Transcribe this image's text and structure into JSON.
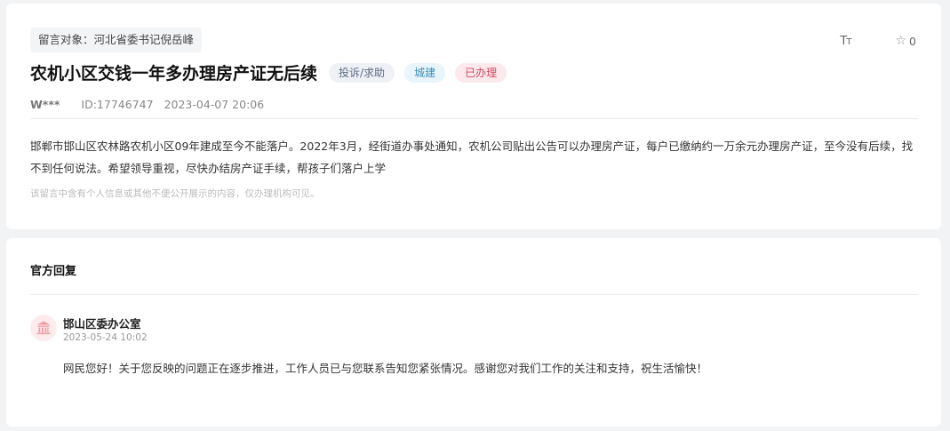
{
  "message": {
    "target_label": "留言对象：河北省委书记倪岳峰",
    "title": "农机小区交钱一年多办理房产证无后续",
    "tags": {
      "type": "投诉/求助",
      "category": "城建",
      "status": "已办理"
    },
    "user": "W***",
    "id": "ID:17746747",
    "datetime": "2023-04-07 20:06",
    "content": "邯郸市邯山区农林路农机小区09年建成至今不能落户。2022年3月，经街道办事处通知，农机公司贴出公告可以办理房产证，每户已缴纳约一万余元办理房产证，至今没有后续，找不到任何说法。希望领导重视，尽快办结房产证手续，帮孩子们落户上学",
    "privacy_notice": "该留言中含有个人信息或其他不便公开展示的内容，仅办理机构可见。"
  },
  "tools": {
    "font_size_icon": "Tт",
    "favorite_count": "0"
  },
  "reply": {
    "section_title": "官方回复",
    "responder": "邯山区委办公室",
    "datetime": "2023-05-24 10:02",
    "content": "网民您好！关于您反映的问题正在逐步推进，工作人员已与您联系告知您紧张情况。感谢您对我们工作的关注和支持，祝生活愉快！"
  },
  "colors": {
    "status_red": "#d6455d",
    "category_blue": "#3f8fb8",
    "avatar_icon": "#f29aa5"
  }
}
